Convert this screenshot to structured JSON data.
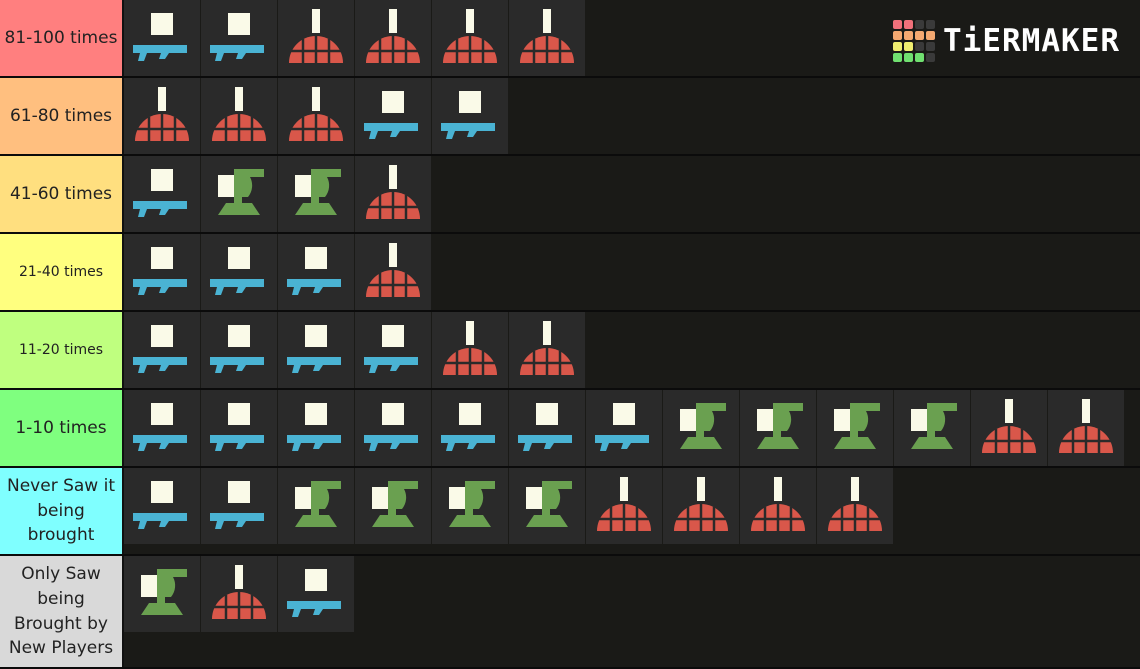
{
  "logo": {
    "text": "TiERMAKER",
    "grid_colors": [
      "#f0707a",
      "#f0707a",
      "#3a3a3a",
      "#3a3a3a",
      "#f4a870",
      "#f4a870",
      "#f4a870",
      "#f4a870",
      "#f0ee70",
      "#f0ee70",
      "#3a3a3a",
      "#3a3a3a",
      "#70e070",
      "#70e070",
      "#70e070",
      "#3a3a3a"
    ]
  },
  "colors": {
    "red": "#d9574a",
    "blue": "#4ab3d3",
    "green": "#6aa050",
    "cream": "#fafae8",
    "tile": "#2a2a2a"
  },
  "tiers": [
    {
      "label": "81-100 times",
      "color": "#ff7f7f",
      "font": "17px",
      "items": [
        {
          "icon": "shield-backpack-icon",
          "dept": "blue"
        },
        {
          "icon": "laser-cannon-icon",
          "dept": "blue"
        },
        {
          "icon": "eagle-500kg-bomb-icon",
          "dept": "red"
        },
        {
          "icon": "eagle-cluster-bomb-icon",
          "dept": "red"
        },
        {
          "icon": "orbital-precision-strike-icon",
          "dept": "red"
        },
        {
          "icon": "orbital-laser-icon",
          "dept": "red"
        }
      ]
    },
    {
      "label": "61-80 times",
      "color": "#ffbf7f",
      "font": "17px",
      "items": [
        {
          "icon": "eagle-airstrike-icon",
          "dept": "red"
        },
        {
          "icon": "orbital-railcannon-strike-icon",
          "dept": "red"
        },
        {
          "icon": "orbital-120mm-barrage-icon",
          "dept": "red"
        },
        {
          "icon": "quasar-cannon-icon",
          "dept": "blue"
        },
        {
          "icon": "flamethrower-icon",
          "dept": "blue"
        }
      ]
    },
    {
      "label": "41-60 times",
      "color": "#ffdf7f",
      "font": "17px",
      "items": [
        {
          "icon": "anti-materiel-rifle-icon",
          "dept": "blue"
        },
        {
          "icon": "autocannon-sentry-icon",
          "dept": "green"
        },
        {
          "icon": "mortar-sentry-icon",
          "dept": "green"
        },
        {
          "icon": "orbital-380mm-barrage-icon",
          "dept": "red"
        }
      ]
    },
    {
      "label": "21-40 times",
      "color": "#ffff7f",
      "font": "14px",
      "items": [
        {
          "icon": "supply-pack-icon",
          "dept": "blue"
        },
        {
          "icon": "spear-icon",
          "dept": "blue"
        },
        {
          "icon": "arc-thrower-icon",
          "dept": "blue"
        },
        {
          "icon": "eagle-110mm-rockets-icon",
          "dept": "red"
        }
      ]
    },
    {
      "label": "11-20 times",
      "color": "#bfff7f",
      "font": "14px",
      "items": [
        {
          "icon": "grenade-launcher-icon",
          "dept": "blue"
        },
        {
          "icon": "autocannon-icon",
          "dept": "blue"
        },
        {
          "icon": "recoilless-rifle-icon",
          "dept": "blue"
        },
        {
          "icon": "expendable-anti-tank-icon",
          "dept": "blue"
        },
        {
          "icon": "eagle-strafing-run-icon",
          "dept": "red"
        },
        {
          "icon": "orbital-walking-barrage-icon",
          "dept": "red"
        }
      ]
    },
    {
      "label": "1-10 times",
      "color": "#7fff7f",
      "font": "17px",
      "items": [
        {
          "icon": "guard-dog-rover-icon",
          "dept": "blue"
        },
        {
          "icon": "ballistic-shield-backpack-icon",
          "dept": "blue"
        },
        {
          "icon": "guard-dog-icon",
          "dept": "blue"
        },
        {
          "icon": "jump-pack-icon",
          "dept": "blue"
        },
        {
          "icon": "railgun-icon",
          "dept": "blue"
        },
        {
          "icon": "laser-cannon-icon",
          "dept": "blue"
        },
        {
          "icon": "machine-gun-icon",
          "dept": "blue"
        },
        {
          "icon": "shield-generator-relay-icon",
          "dept": "green"
        },
        {
          "icon": "tesla-tower-icon",
          "dept": "green"
        },
        {
          "icon": "gatling-sentry-icon",
          "dept": "green"
        },
        {
          "icon": "incendiary-mines-icon",
          "dept": "green"
        },
        {
          "icon": "orbital-gatling-barrage-icon",
          "dept": "red"
        },
        {
          "icon": "eagle-smoke-strike-icon",
          "dept": "red"
        }
      ]
    },
    {
      "label": "Never Saw it being brought",
      "color": "#7fffff",
      "font": "17px",
      "items": [
        {
          "icon": "commando-icon",
          "dept": "blue"
        },
        {
          "icon": "directional-shield-backpack-icon",
          "dept": "blue"
        },
        {
          "icon": "rocket-sentry-icon",
          "dept": "green"
        },
        {
          "icon": "anti-personnel-minefield-icon",
          "dept": "green"
        },
        {
          "icon": "tesla-mines-icon",
          "dept": "green"
        },
        {
          "icon": "hmg-emplacement-icon",
          "dept": "green"
        },
        {
          "icon": "orbital-ems-strike-icon",
          "dept": "red"
        },
        {
          "icon": "orbital-gas-strike-icon",
          "dept": "red"
        },
        {
          "icon": "eagle-napalm-strike-icon",
          "dept": "red"
        },
        {
          "icon": "orbital-smoke-strike-icon",
          "dept": "red"
        }
      ]
    },
    {
      "label": "Only Saw being Brought by New Players",
      "color": "#d9d9d9",
      "font": "17px",
      "items": [
        {
          "icon": "machine-gun-sentry-icon",
          "dept": "green"
        },
        {
          "icon": "orbital-airburst-strike-icon",
          "dept": "red"
        },
        {
          "icon": "stalwart-icon",
          "dept": "blue"
        }
      ]
    }
  ]
}
